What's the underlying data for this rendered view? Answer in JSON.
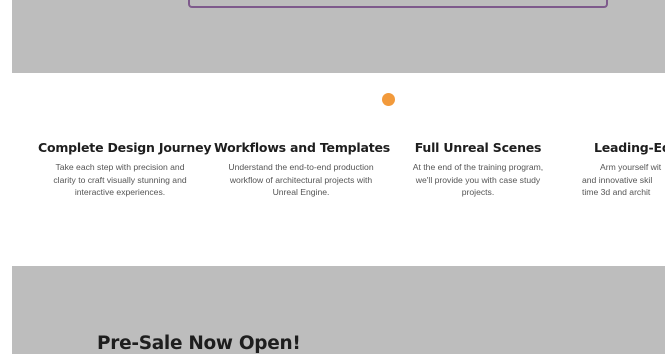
{
  "features": [
    {
      "title": "Complete Design Journey",
      "lines": [
        "Take each step with precision and",
        "clarity to craft visually stunning and",
        "interactive experiences."
      ]
    },
    {
      "title": "Workflows and Templates",
      "lines": [
        "Understand the end-to-end production",
        "workflow of architectural projects with",
        "Unreal Engine."
      ]
    },
    {
      "title": "Full Unreal Scenes",
      "lines": [
        "At the end of the training program,",
        "we'll provide you with case study",
        "projects."
      ]
    },
    {
      "title": "Leading-Ed",
      "lines": [
        "Arm yourself wit",
        "and innovative skil",
        "time 3d and archit"
      ]
    }
  ],
  "presale": {
    "heading": "Pre-Sale Now Open!"
  },
  "colors": {
    "band": "#bdbdbd",
    "dot": "#f29a3b",
    "accent_border": "#7e5a8c"
  }
}
